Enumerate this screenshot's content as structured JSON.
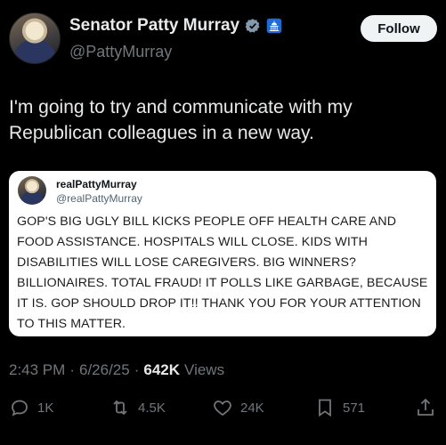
{
  "author": {
    "display_name": "Senator Patty Murray",
    "handle": "@PattyMurray"
  },
  "follow_label": "Follow",
  "post": {
    "text": "I'm going to try and communicate with my Republican colleagues in a new way."
  },
  "quoted_card": {
    "name": "realPattyMurray",
    "handle": "@realPattyMurray",
    "body": "GOP'S BIG UGLY BILL KICKS PEOPLE OFF HEALTH CARE AND FOOD ASSISTANCE. HOSPITALS WILL CLOSE. KIDS WITH DISABILITIES WILL LOSE CAREGIVERS. BIG WINNERS? BILLIONAIRES. TOTAL FRAUD! IT POLLS LIKE GARBAGE, BECAUSE IT IS. GOP SHOULD DROP IT!! THANK YOU FOR YOUR ATTENTION TO THIS MATTER."
  },
  "meta": {
    "time": "2:43 PM",
    "separator": "·",
    "date": "6/26/25",
    "views_count": "642K",
    "views_label": "Views"
  },
  "actions": {
    "replies": "1K",
    "reposts": "4.5K",
    "likes": "24K",
    "bookmarks": "571"
  },
  "icons": {
    "verified": "verified-badge-icon",
    "government": "government-capitol-badge-icon",
    "reply": "reply-icon",
    "repost": "repost-icon",
    "like": "heart-icon",
    "bookmark": "bookmark-icon",
    "share": "share-icon"
  },
  "colors": {
    "background": "#000000",
    "text_primary": "#e7e9ea",
    "text_secondary": "#71767b",
    "verified_gray": "#829aab",
    "gov_badge_blue": "#1d6bd8"
  }
}
